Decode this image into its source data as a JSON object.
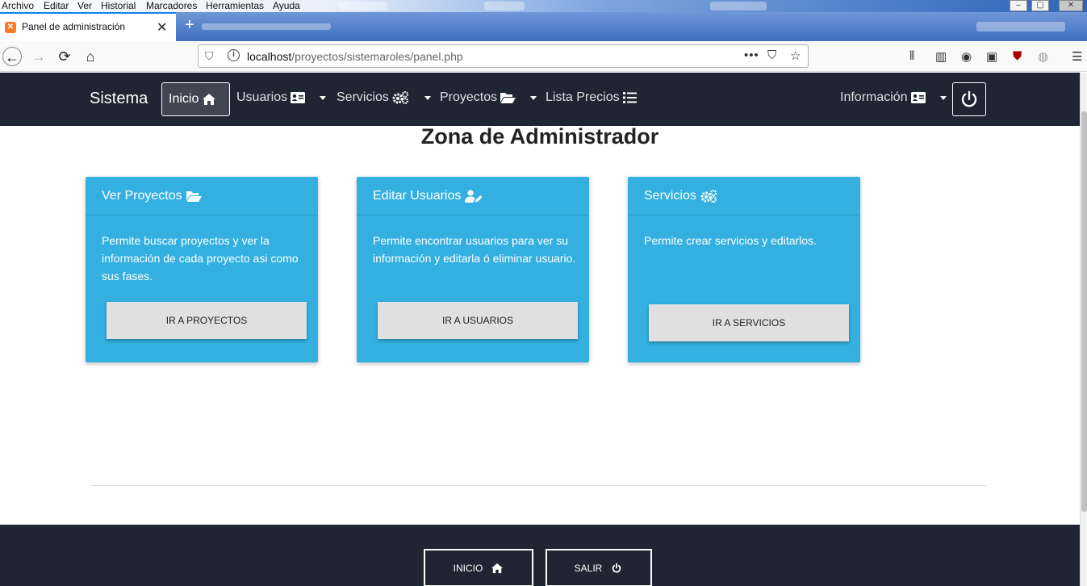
{
  "browser": {
    "menu": [
      "Archivo",
      "Editar",
      "Ver",
      "Historial",
      "Marcadores",
      "Herramientas",
      "Ayuda"
    ],
    "tab_title": "Panel de administración",
    "url_host": "localhost",
    "url_path": "/proyectos/sistemaroles/panel.php",
    "page_actions": "•••"
  },
  "app": {
    "brand": "Sistema",
    "nav": {
      "inicio": "Inicio",
      "usuarios": "Usuarios",
      "servicios": "Servicios",
      "proyectos": "Proyectos",
      "lista_precios": "Lista Precios",
      "informacion": "Información"
    },
    "heading": "Zona de Administrador",
    "cards": [
      {
        "title": "Ver Proyectos",
        "icon": "folder-open-icon",
        "text": "Permite buscar proyectos y ver la información de cada proyecto asi como sus fases.",
        "button": "IR A PROYECTOS"
      },
      {
        "title": "Editar Usuarios",
        "icon": "user-edit-icon",
        "text": "Permite encontrar usuarios para ver su información y editarla ó eliminar usuario.",
        "button": "IR A USUARIOS"
      },
      {
        "title": "Servicios",
        "icon": "cogs-icon",
        "text": "Permite crear servicios y editarlos.",
        "button": "IR A SERVICIOS"
      }
    ],
    "footer": {
      "inicio": "INICIO",
      "salir": "SALIR"
    }
  },
  "colors": {
    "navbar_bg": "#1f2533",
    "card_bg": "#33b0e0",
    "button_bg": "#e0e0e0"
  }
}
